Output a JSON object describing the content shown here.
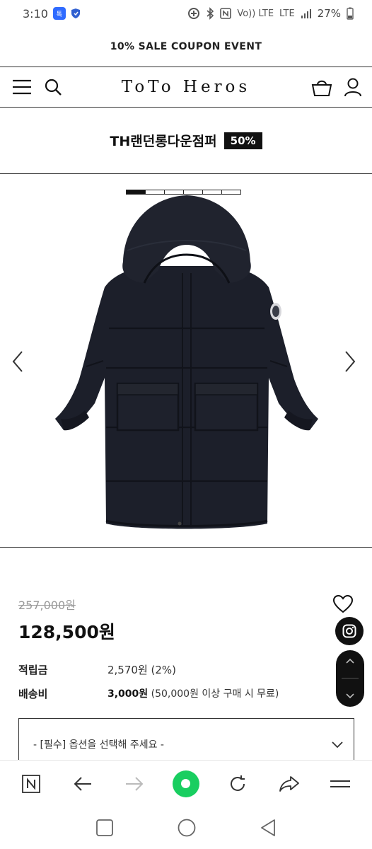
{
  "status_bar": {
    "time": "3:10",
    "battery": "27%",
    "carrier": "Vo)) LTE",
    "network": "LTE"
  },
  "promo": {
    "text": "10% SALE COUPON EVENT"
  },
  "header": {
    "logo": "ToTo Heros"
  },
  "product": {
    "name": "TH랜던롱다운점퍼",
    "discount": "50%",
    "original_price": "257,000원",
    "sale_price": "128,500원",
    "points_label": "적립금",
    "points_value": "2,570원 (2%)",
    "shipping_label": "배송비",
    "shipping_fee": "3,000원",
    "shipping_note": "(50,000원 이상 구매 시 무료)",
    "image_count": 6,
    "image_index": 1
  },
  "option_select": {
    "placeholder": "- [필수] 옵션을 선택해 주세요 -"
  },
  "colors": {
    "accent_green": "#19ce60",
    "jacket": "#1c1f2a",
    "black": "#111111"
  },
  "icons": {
    "menu": "menu-icon",
    "search": "search-icon",
    "cart": "bag-icon",
    "user": "user-icon",
    "heart": "heart-icon",
    "instagram": "instagram-icon"
  }
}
